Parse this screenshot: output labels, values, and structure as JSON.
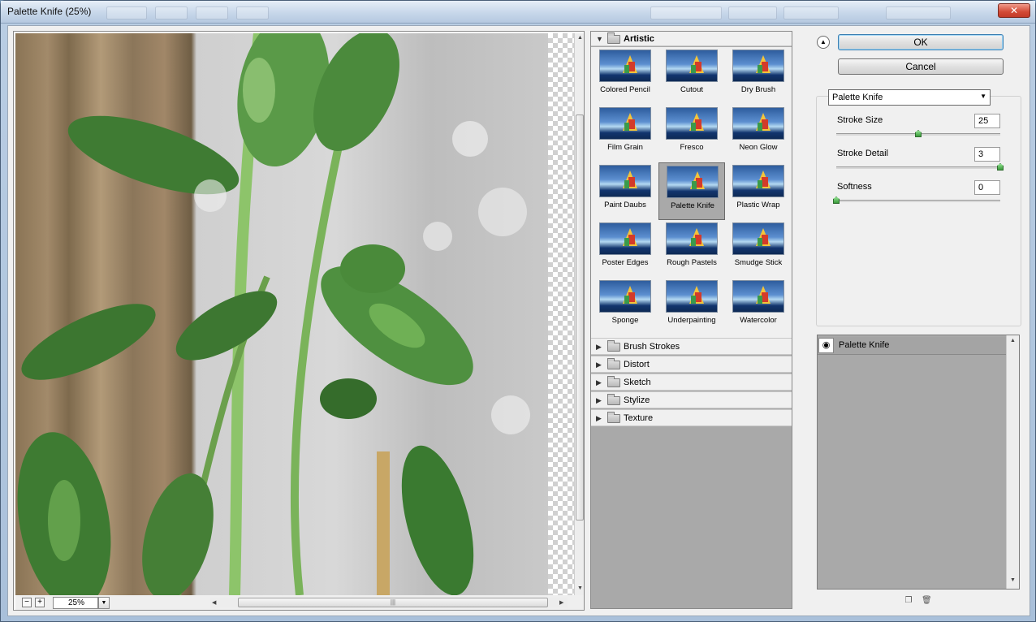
{
  "window": {
    "title": "Palette Knife (25%)",
    "close_glyph": "✕"
  },
  "preview": {
    "zoom": "25%",
    "zoom_out_glyph": "−",
    "zoom_in_glyph": "+"
  },
  "gallery": {
    "expanded_category": "Artistic",
    "filters": [
      {
        "label": "Colored Pencil"
      },
      {
        "label": "Cutout"
      },
      {
        "label": "Dry Brush"
      },
      {
        "label": "Film Grain"
      },
      {
        "label": "Fresco"
      },
      {
        "label": "Neon Glow"
      },
      {
        "label": "Paint Daubs"
      },
      {
        "label": "Palette Knife",
        "selected": true
      },
      {
        "label": "Plastic Wrap"
      },
      {
        "label": "Poster Edges"
      },
      {
        "label": "Rough Pastels"
      },
      {
        "label": "Smudge Stick"
      },
      {
        "label": "Sponge"
      },
      {
        "label": "Underpainting"
      },
      {
        "label": "Watercolor"
      }
    ],
    "collapsed_categories": [
      "Brush Strokes",
      "Distort",
      "Sketch",
      "Stylize",
      "Texture"
    ]
  },
  "buttons": {
    "ok": "OK",
    "cancel": "Cancel"
  },
  "settings": {
    "filter_select": "Palette Knife",
    "params": [
      {
        "label": "Stroke Size",
        "value": "25",
        "slider_fraction": 0.5
      },
      {
        "label": "Stroke Detail",
        "value": "3",
        "slider_fraction": 1.0
      },
      {
        "label": "Softness",
        "value": "0",
        "slider_fraction": 0.0
      }
    ]
  },
  "layers": {
    "items": [
      {
        "name": "Palette Knife",
        "visible": true
      }
    ]
  },
  "icons": {
    "collapse": "chevron-up-icon",
    "eye": "eye-icon",
    "new_layer": "new-effect-layer-icon",
    "delete": "trash-icon"
  }
}
